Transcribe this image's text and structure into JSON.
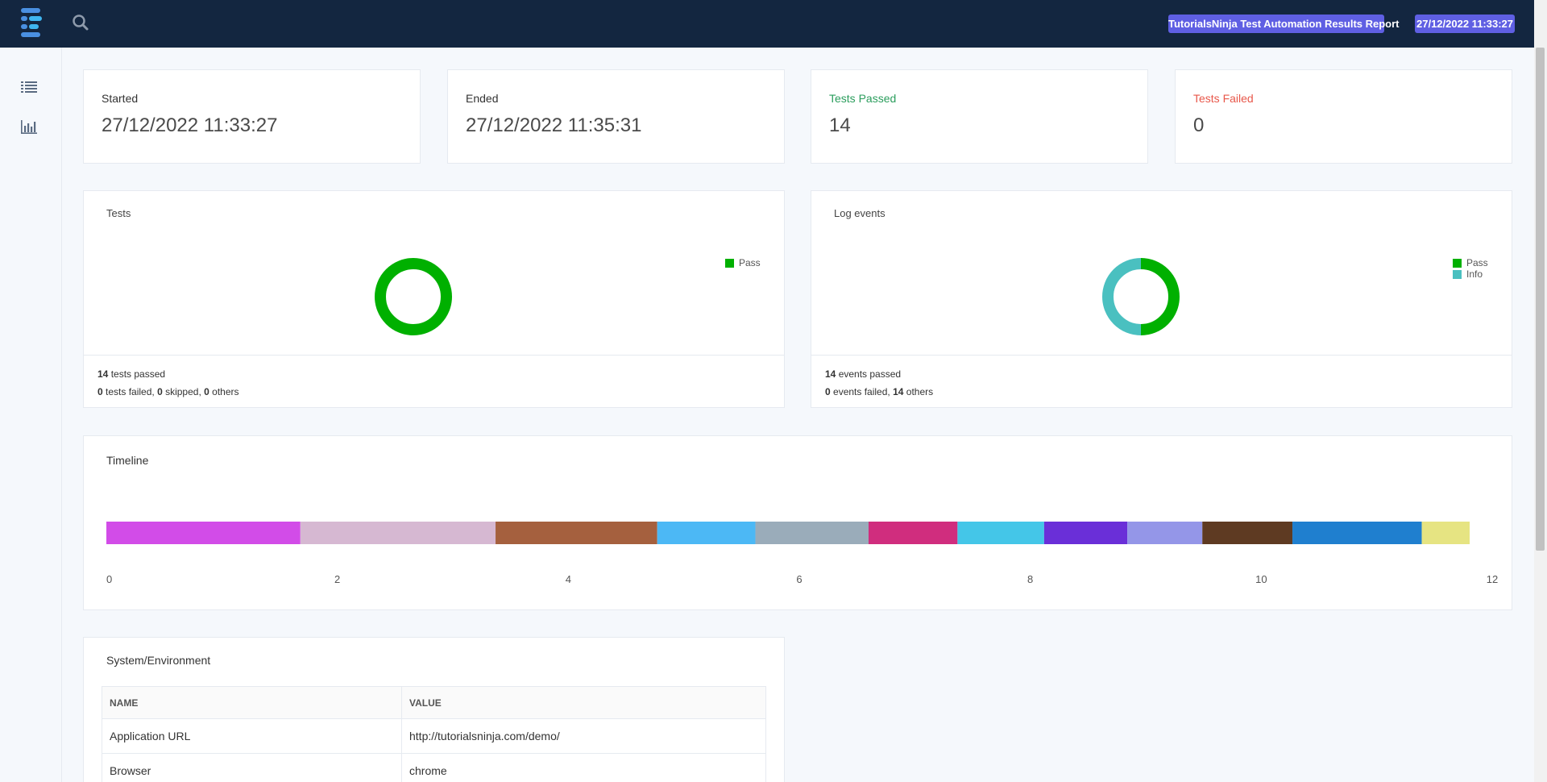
{
  "header": {
    "report_title": "TutorialsNinja Test Automation Results Report",
    "report_date": "27/12/2022 11:33:27",
    "badge_color": "#5f5fe3",
    "bar_color": "#132640",
    "icons": [
      "extent-logo-icon",
      "search-icon"
    ]
  },
  "sidebar": {
    "items": [
      {
        "icon": "list-icon"
      },
      {
        "icon": "bar-chart-icon"
      }
    ]
  },
  "stats": {
    "started": {
      "label": "Started",
      "value": "27/12/2022 11:33:27"
    },
    "ended": {
      "label": "Ended",
      "value": "27/12/2022 11:35:31"
    },
    "passed": {
      "label": "Tests Passed",
      "value": "14"
    },
    "failed": {
      "label": "Tests Failed",
      "value": "0"
    }
  },
  "tests_card": {
    "title": "Tests",
    "legend": [
      {
        "label": "Pass",
        "color": "#00b000"
      }
    ],
    "footer": {
      "passed_count": "14",
      "passed_text": " tests passed",
      "failed_count": "0",
      "failed_text": " tests failed, ",
      "skipped_count": "0",
      "skipped_text": " skipped, ",
      "others_count": "0",
      "others_text": " others"
    }
  },
  "events_card": {
    "title": "Log events",
    "legend": [
      {
        "label": "Pass",
        "color": "#00b000"
      },
      {
        "label": "Info",
        "color": "#4ac0c0"
      }
    ],
    "footer": {
      "passed_count": "14",
      "passed_text": " events passed",
      "failed_count": "0",
      "failed_text": " events failed, ",
      "others_count": "14",
      "others_text": " others"
    }
  },
  "timeline": {
    "title": "Timeline",
    "axis_ticks": [
      "0",
      "2",
      "4",
      "6",
      "8",
      "10",
      "12"
    ]
  },
  "environment": {
    "title": "System/Environment",
    "columns": [
      "NAME",
      "VALUE"
    ],
    "rows": [
      {
        "name": "Application URL",
        "value": "http://tutorialsninja.com/demo/"
      },
      {
        "name": "Browser",
        "value": "chrome"
      }
    ]
  },
  "chart_data": [
    {
      "type": "pie",
      "variant": "doughnut",
      "title": "Tests",
      "labels": [
        "Pass"
      ],
      "values": [
        14
      ],
      "colors": [
        "#00b000"
      ],
      "legend": "top-right"
    },
    {
      "type": "pie",
      "variant": "doughnut",
      "title": "Log events",
      "labels": [
        "Pass",
        "Info"
      ],
      "values": [
        14,
        14
      ],
      "colors": [
        "#00b000",
        "#4ac0c0"
      ],
      "legend": "top-right"
    },
    {
      "type": "bar",
      "variant": "stacked-horizontal",
      "title": "Timeline",
      "xlim": [
        0,
        12
      ],
      "x_ticks": [
        0,
        2,
        4,
        6,
        8,
        10,
        12
      ],
      "series": [
        {
          "values": [
            1.68
          ],
          "color": "#d24ce8"
        },
        {
          "values": [
            1.69
          ],
          "color": "#d6b8d2"
        },
        {
          "values": [
            1.4
          ],
          "color": "#a5603e"
        },
        {
          "values": [
            0.85
          ],
          "color": "#4cb8f5"
        },
        {
          "values": [
            0.98
          ],
          "color": "#9aacba"
        },
        {
          "values": [
            0.77
          ],
          "color": "#d02d7e"
        },
        {
          "values": [
            0.75
          ],
          "color": "#44c6e8"
        },
        {
          "values": [
            0.72
          ],
          "color": "#6a2fd8"
        },
        {
          "values": [
            0.65
          ],
          "color": "#9496e8"
        },
        {
          "values": [
            0.78
          ],
          "color": "#5e3a22"
        },
        {
          "values": [
            1.12
          ],
          "color": "#1f7fcf"
        },
        {
          "values": [
            0.51
          ],
          "color": "#e6e482"
        }
      ]
    }
  ]
}
